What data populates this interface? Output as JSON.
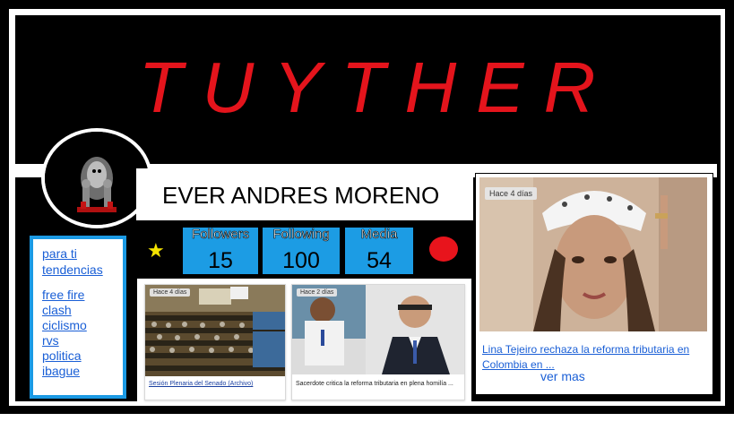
{
  "brand": {
    "title": "TUYTHER"
  },
  "profile": {
    "name": "EVER ANDRES MORENO"
  },
  "nav": {
    "primary": [
      "para ti",
      "tendencias"
    ],
    "topics": [
      "free fire",
      "clash",
      "ciclismo",
      "rvs",
      "politica",
      "ibague"
    ]
  },
  "stats": [
    {
      "label": "Followers",
      "value": "15"
    },
    {
      "label": "Following",
      "value": "100"
    },
    {
      "label": "Media",
      "value": "54"
    }
  ],
  "feed": [
    {
      "badge": "Hace 4 días",
      "caption": "Sesión Plenaria del Senado (Archivo)"
    },
    {
      "badge": "Hace 2 días",
      "caption": "Sacerdote critica la reforma tributaria en plena homilía ..."
    }
  ],
  "feature": {
    "badge": "Hace 4 días",
    "caption": "Lina Tejeiro rechaza la reforma tributaria en Colombia en ..."
  },
  "more_label": "ver mas",
  "colors": {
    "brand_red": "#e4141c",
    "accent_blue": "#1c9ce4",
    "link_blue": "#1a5fd6",
    "star_yellow": "#f5e400"
  }
}
